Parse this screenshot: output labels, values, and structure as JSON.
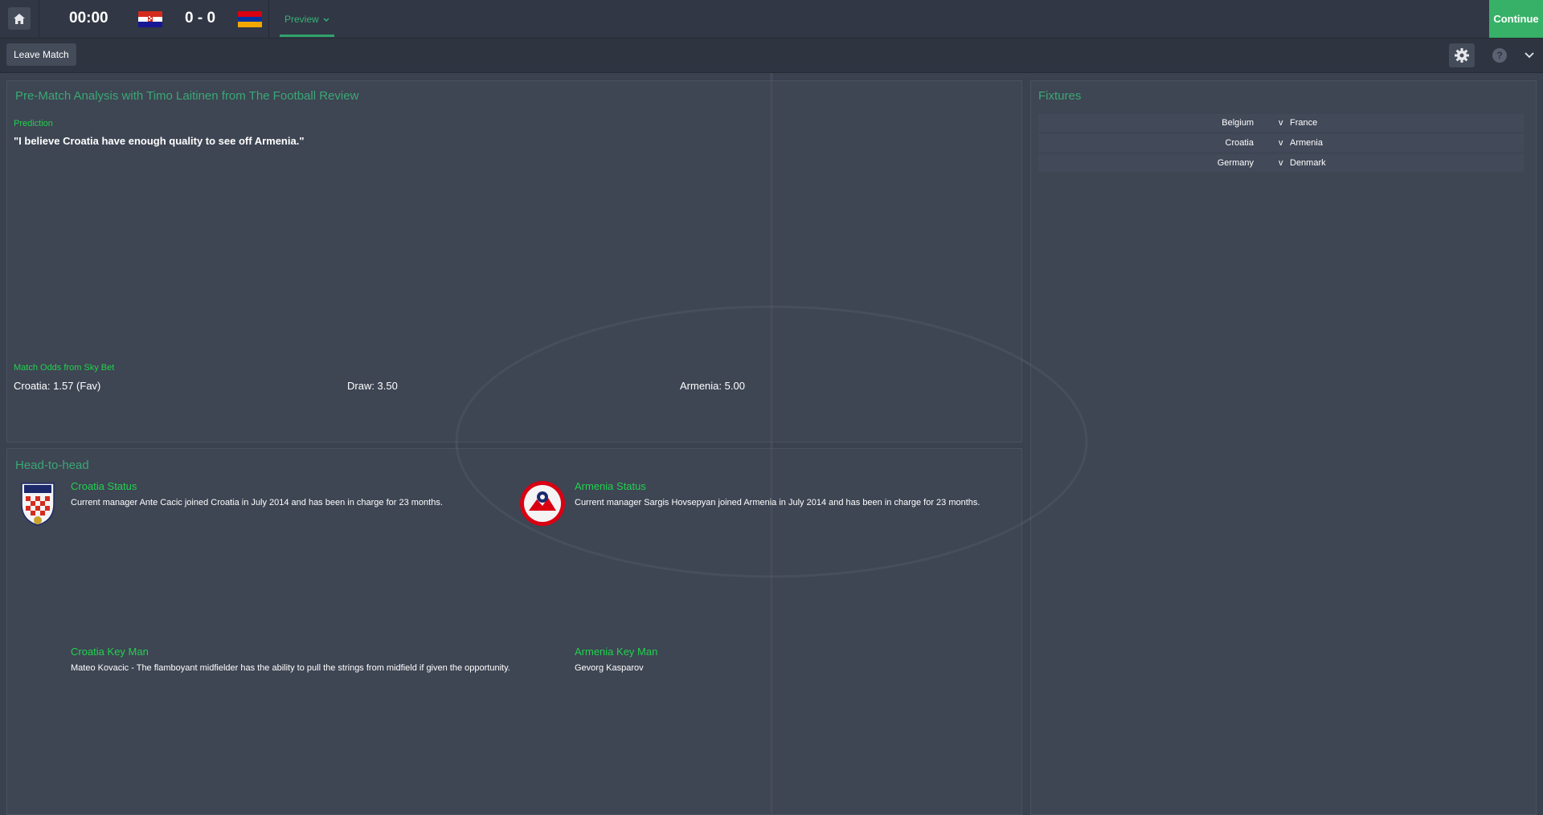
{
  "topbar": {
    "clock": "00:00",
    "score": "0 - 0",
    "tab_label": "Preview",
    "continue_label": "Continue"
  },
  "subbar": {
    "leave_label": "Leave Match",
    "help_label": "?"
  },
  "analysis": {
    "title": "Pre-Match Analysis with Timo Laitinen from The Football Review",
    "prediction_label": "Prediction",
    "prediction_quote": "\"I believe Croatia have enough quality to see off Armenia.\"",
    "odds_label": "Match Odds from Sky Bet",
    "odds_home": "Croatia: 1.57 (Fav)",
    "odds_draw": "Draw: 3.50",
    "odds_away": "Armenia: 5.00"
  },
  "head_to_head": {
    "title": "Head-to-head",
    "home_status_title": "Croatia Status",
    "home_status_text": "Current manager Ante Cacic joined Croatia in July 2014 and has been in charge for 23 months.",
    "away_status_title": "Armenia Status",
    "away_status_text": "Current manager Sargis Hovsepyan joined Armenia in July 2014 and has been in charge for 23 months.",
    "home_keyman_title": "Croatia Key Man",
    "home_keyman_text": "Mateo Kovacic - The flamboyant midfielder has the ability to pull the strings from midfield if given the opportunity.",
    "away_keyman_title": "Armenia Key Man",
    "away_keyman_text": "Gevorg Kasparov"
  },
  "fixtures": {
    "title": "Fixtures",
    "rows": [
      {
        "home": "Belgium",
        "sep": "v",
        "away": "France"
      },
      {
        "home": "Croatia",
        "sep": "v",
        "away": "Armenia"
      },
      {
        "home": "Germany",
        "sep": "v",
        "away": "Denmark"
      }
    ]
  },
  "colors": {
    "accent_green": "#37b167",
    "label_green": "#22d14e",
    "title_green": "#3aa874",
    "background": "#3a414f"
  },
  "icons": [
    "home-icon",
    "croatia-flag-icon",
    "armenia-flag-icon",
    "chevron-down-icon",
    "gear-icon",
    "help-icon",
    "croatia-crest-icon",
    "armenia-crest-icon"
  ]
}
